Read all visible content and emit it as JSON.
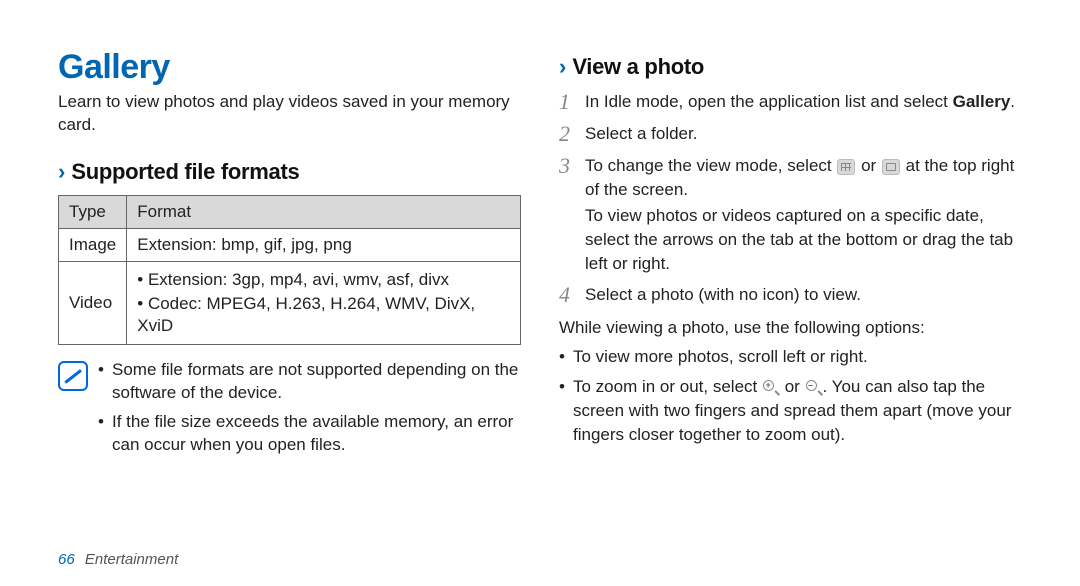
{
  "title": "Gallery",
  "intro": "Learn to view photos and play videos saved in your memory card.",
  "section1": {
    "chevron": "›",
    "heading": "Supported file formats",
    "table": {
      "head": {
        "c1": "Type",
        "c2": "Format"
      },
      "rows": [
        {
          "type": "Image",
          "format_single": "Extension: bmp, gif, jpg, png"
        },
        {
          "type": "Video",
          "format_list": [
            "Extension: 3gp, mp4, avi, wmv, asf, divx",
            "Codec: MPEG4, H.263, H.264, WMV, DivX, XviD"
          ]
        }
      ]
    },
    "notes": [
      "Some file formats are not supported depending on the software of the device.",
      "If the file size exceeds the available memory, an error can occur when you open files."
    ]
  },
  "section2": {
    "chevron": "›",
    "heading": "View a photo",
    "steps": [
      {
        "num": "1",
        "text_pre": "In Idle mode, open the application list and select ",
        "bold": "Gallery",
        "text_post": "."
      },
      {
        "num": "2",
        "text_pre": "Select a folder."
      },
      {
        "num": "3",
        "text_pre": "To change the view mode, select ",
        "mid_between": " or ",
        "text_mid": " at the top right of the screen.",
        "para2": "To view photos or videos captured on a specific date, select the arrows on the tab at the bottom or drag the tab left or right."
      },
      {
        "num": "4",
        "text_pre": "Select a photo (with no icon) to view."
      }
    ],
    "after": "While viewing a photo, use the following options:",
    "bullets": [
      {
        "text": "To view more photos, scroll left or right."
      },
      {
        "pre": "To zoom in or out, select ",
        "mid": " or ",
        "post": ". You can also tap the screen with two fingers and spread them apart (move your fingers closer together to zoom out)."
      }
    ]
  },
  "footer": {
    "page": "66",
    "section": "Entertainment"
  }
}
